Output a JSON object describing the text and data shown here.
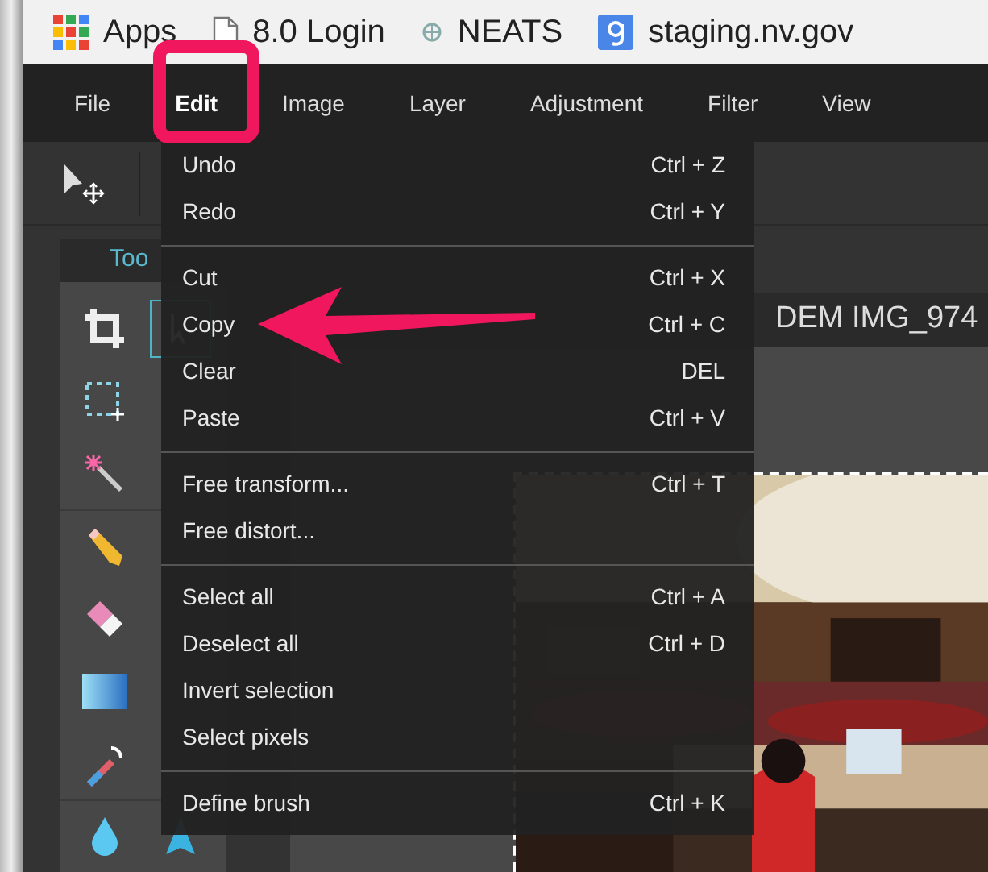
{
  "bookmarks": [
    {
      "kind": "apps",
      "label": "Apps"
    },
    {
      "kind": "page",
      "label": "8.0 Login"
    },
    {
      "kind": "site",
      "label": "NEATS"
    },
    {
      "kind": "google",
      "label": "staging.nv.gov"
    }
  ],
  "menu_bar": [
    {
      "label": "File",
      "selected": false
    },
    {
      "label": "Edit",
      "selected": true
    },
    {
      "label": "Image",
      "selected": false
    },
    {
      "label": "Layer",
      "selected": false
    },
    {
      "label": "Adjustment",
      "selected": false
    },
    {
      "label": "Filter",
      "selected": false
    },
    {
      "label": "View",
      "selected": false
    }
  ],
  "tools_panel": {
    "tab": "Too",
    "rows": [
      {
        "left": {
          "kind": "crop"
        },
        "right": {
          "kind": "move",
          "selected": true
        }
      },
      {
        "left": {
          "kind": "marquee"
        }
      },
      {
        "left": {
          "kind": "wand"
        }
      },
      {
        "left": {
          "kind": "pencil"
        }
      },
      {
        "left": {
          "kind": "eraser"
        }
      },
      {
        "left": {
          "kind": "gradient"
        }
      },
      {
        "left": {
          "kind": "replace"
        }
      },
      {
        "left": {
          "kind": "drop"
        },
        "right": {
          "kind": "sharpen",
          "selected": false
        }
      }
    ]
  },
  "document_tab": "DEM IMG_974",
  "edit_menu": {
    "groups": [
      [
        {
          "label": "Undo",
          "shortcut": "Ctrl + Z"
        },
        {
          "label": "Redo",
          "shortcut": "Ctrl + Y"
        }
      ],
      [
        {
          "label": "Cut",
          "shortcut": "Ctrl + X"
        },
        {
          "label": "Copy",
          "shortcut": "Ctrl + C"
        },
        {
          "label": "Clear",
          "shortcut": "DEL"
        },
        {
          "label": "Paste",
          "shortcut": "Ctrl + V"
        }
      ],
      [
        {
          "label": "Free transform...",
          "shortcut": "Ctrl + T"
        },
        {
          "label": "Free distort..."
        }
      ],
      [
        {
          "label": "Select all",
          "shortcut": "Ctrl + A"
        },
        {
          "label": "Deselect all",
          "shortcut": "Ctrl + D"
        },
        {
          "label": "Invert selection"
        },
        {
          "label": "Select pixels"
        }
      ],
      [
        {
          "label": "Define brush",
          "shortcut": "Ctrl + K"
        }
      ]
    ]
  }
}
